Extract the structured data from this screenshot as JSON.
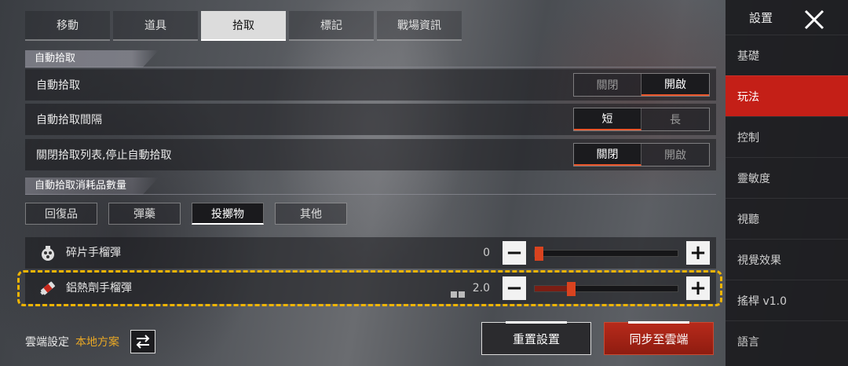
{
  "tabs": [
    "移動",
    "道具",
    "拾取",
    "標記",
    "戰場資訊"
  ],
  "active_tab": 2,
  "section_auto_pickup": {
    "header": "自動拾取",
    "rows": [
      {
        "label": "自動拾取",
        "options": [
          "關閉",
          "開啟"
        ],
        "selected": 1
      },
      {
        "label": "自動拾取間隔",
        "options": [
          "短",
          "長"
        ],
        "selected": 0
      },
      {
        "label": "關閉拾取列表,停止自動拾取",
        "options": [
          "關閉",
          "開啟"
        ],
        "selected": 0
      }
    ]
  },
  "section_consumables": {
    "header": "自動拾取消耗品數量",
    "categories": [
      "回復品",
      "彈藥",
      "投擲物",
      "其他"
    ],
    "active_category": 2,
    "items": [
      {
        "name": "碎片手榴彈",
        "value": "0",
        "level": 0.02
      },
      {
        "name": "鋁熱劑手榴彈",
        "value": "2.0",
        "level": 0.25
      }
    ]
  },
  "footer": {
    "cloud_label": "雲端設定",
    "cloud_value": "本地方案",
    "reset_label": "重置設置",
    "sync_label": "同步至雲端"
  },
  "sidebar": {
    "title": "設置",
    "items": [
      "基礎",
      "玩法",
      "控制",
      "靈敏度",
      "視聽",
      "視覺效果",
      "搖桿 v1.0",
      "語言"
    ],
    "active": 1
  },
  "colors": {
    "accent_red": "#c41f17",
    "accent_orange": "#e8552a",
    "highlight_yellow": "#f0b400",
    "gold_text": "#e9a825"
  }
}
